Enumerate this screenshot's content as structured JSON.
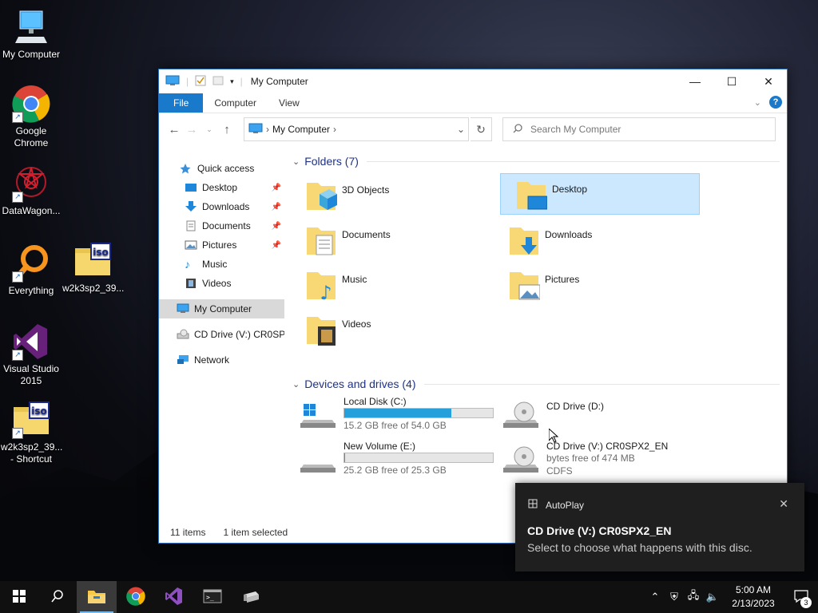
{
  "desktop": {
    "icons": [
      {
        "label": "My Computer"
      },
      {
        "label": "Google Chrome"
      },
      {
        "label": "DataWagon..."
      },
      {
        "label": "Everything"
      },
      {
        "label": "w2k3sp2_39..."
      },
      {
        "label": "Visual Studio 2015"
      },
      {
        "label": "w2k3sp2_39... - Shortcut"
      }
    ]
  },
  "window": {
    "title": "My Computer",
    "ribbon": {
      "file": "File",
      "computer": "Computer",
      "view": "View",
      "help": "?"
    },
    "address": {
      "crumb": "My Computer",
      "sep": "›"
    },
    "search_placeholder": "Search My Computer",
    "nav": {
      "quick_access": "Quick access",
      "items": [
        {
          "label": "Desktop",
          "pinned": true
        },
        {
          "label": "Downloads",
          "pinned": true
        },
        {
          "label": "Documents",
          "pinned": true
        },
        {
          "label": "Pictures",
          "pinned": true
        },
        {
          "label": "Music",
          "pinned": false
        },
        {
          "label": "Videos",
          "pinned": false
        }
      ],
      "my_computer": "My Computer",
      "cd_drive": "CD Drive (V:) CR0SPX",
      "network": "Network"
    },
    "folders_header": "Folders (7)",
    "folders": [
      {
        "name": "3D Objects",
        "selected": false
      },
      {
        "name": "Desktop",
        "selected": true
      },
      {
        "name": "Documents",
        "selected": false
      },
      {
        "name": "Downloads",
        "selected": false
      },
      {
        "name": "Music",
        "selected": false
      },
      {
        "name": "Pictures",
        "selected": false
      },
      {
        "name": "Videos",
        "selected": false
      }
    ],
    "drives_header": "Devices and drives (4)",
    "drives": [
      {
        "name": "Local Disk (C:)",
        "free": "15.2 GB free of 54.0 GB",
        "used_fraction": 0.72
      },
      {
        "name": "CD Drive (D:)"
      },
      {
        "name": "New Volume (E:)",
        "free": "25.2 GB free of 25.3 GB",
        "used_fraction": 0.004
      },
      {
        "name": "CD Drive (V:) CR0SPX2_EN",
        "free": "bytes free of 474 MB",
        "fs": "CDFS"
      }
    ],
    "status": {
      "items": "11 items",
      "selected": "1 item selected"
    }
  },
  "toast": {
    "app": "AutoPlay",
    "title": "CD Drive (V:) CR0SPX2_EN",
    "message": "Select to choose what happens with this disc."
  },
  "taskbar": {
    "time": "5:00 AM",
    "date": "2/13/2023",
    "notification_count": "3"
  },
  "colors": {
    "accent": "#1979ca",
    "selection": "#cce8ff",
    "drive_fill": "#26a0da"
  }
}
